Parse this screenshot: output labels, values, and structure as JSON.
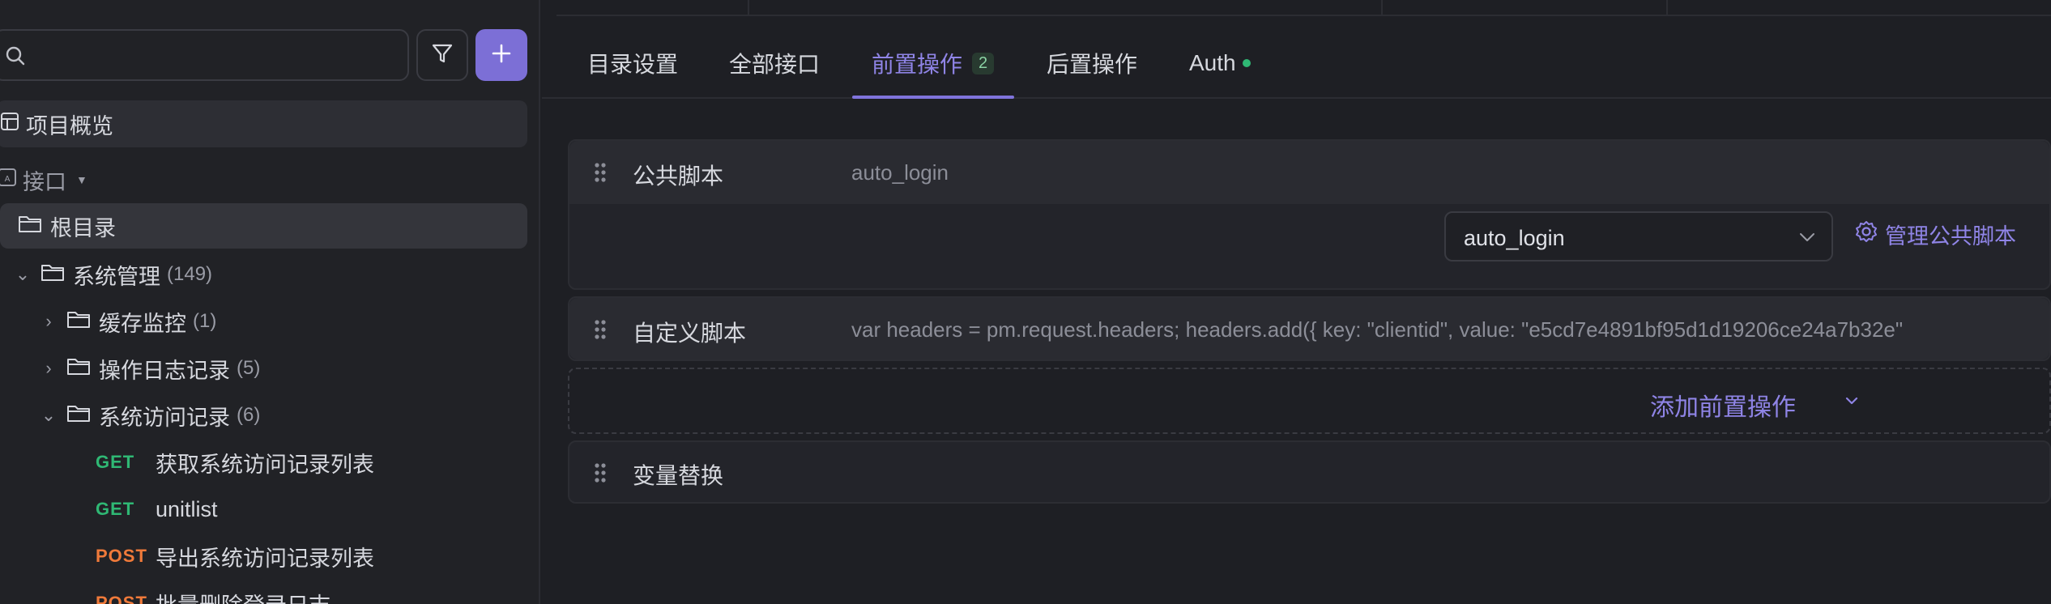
{
  "sidebar": {
    "search": {
      "placeholder": ""
    },
    "overview_label": "项目概览",
    "api_section_label": "接口",
    "root_label": "根目录",
    "tree": [
      {
        "label": "系统管理",
        "count": "(149)"
      },
      {
        "label": "缓存监控",
        "count": "(1)"
      },
      {
        "label": "操作日志记录",
        "count": "(5)"
      },
      {
        "label": "系统访问记录",
        "count": "(6)"
      }
    ],
    "apis": [
      {
        "method": "GET",
        "name": "获取系统访问记录列表"
      },
      {
        "method": "GET",
        "name": "unitlist"
      },
      {
        "method": "POST",
        "name": "导出系统访问记录列表"
      },
      {
        "method": "POST",
        "name": "批量删除登录日志"
      }
    ]
  },
  "tabs": [
    {
      "label": "目录设置"
    },
    {
      "label": "全部接口"
    },
    {
      "label": "前置操作",
      "badge": "2"
    },
    {
      "label": "后置操作"
    },
    {
      "label": "Auth"
    }
  ],
  "pre_ops": {
    "public_script": {
      "title": "公共脚本",
      "value": "auto_login",
      "selected": "auto_login",
      "manage_label": "管理公共脚本"
    },
    "custom_script": {
      "title": "自定义脚本",
      "value": "var headers = pm.request.headers; headers.add({ key: \"clientid\", value: \"e5cd7e4891bf95d1d19206ce24a7b32e\""
    },
    "add_label": "添加前置操作",
    "variable_replace": {
      "title": "变量替换"
    }
  },
  "colors": {
    "accent": "#7c6fd6",
    "get": "#2fb874",
    "post": "#f07a3a",
    "auth_dot": "#2fb874"
  }
}
